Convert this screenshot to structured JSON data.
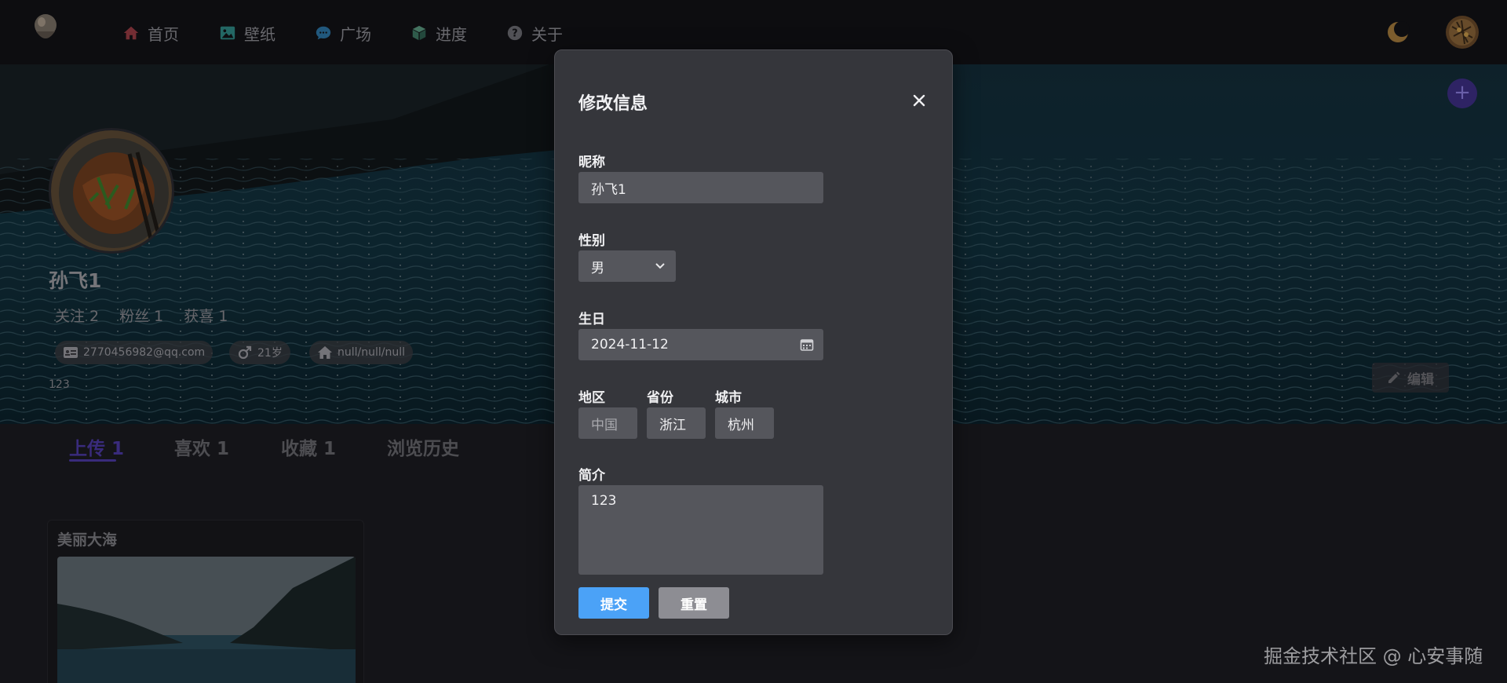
{
  "nav": {
    "items": [
      {
        "label": "首页",
        "icon": "home-icon",
        "color": "#9a3c44"
      },
      {
        "label": "壁纸",
        "icon": "image-icon",
        "color": "#2f8a86"
      },
      {
        "label": "广场",
        "icon": "chat-icon",
        "color": "#2d76a7"
      },
      {
        "label": "进度",
        "icon": "box-icon",
        "color": "#3f7a65"
      },
      {
        "label": "关于",
        "icon": "question-icon",
        "color": "#6d6d73"
      }
    ]
  },
  "profile": {
    "name": "孙飞1",
    "stats": [
      "关注 2",
      "粉丝 1",
      "获喜 1"
    ],
    "email": "2770456982@qq.com",
    "age": "21岁",
    "location": "null/null/null",
    "bio": "123",
    "edit_label": "编辑",
    "add_label": "+"
  },
  "tabs": [
    "上传 1",
    "喜欢 1",
    "收藏 1",
    "浏览历史"
  ],
  "card": {
    "title": "美丽大海"
  },
  "watermark": "掘金技术社区 @ 心安事随",
  "modal": {
    "title": "修改信息",
    "close": "✕",
    "nickname_label": "昵称",
    "nickname_value": "孙飞1",
    "gender_label": "性别",
    "gender_value": "男",
    "birthday_label": "生日",
    "birthday_value": "2024-11-12",
    "region_label": "地区",
    "region_value": "中国",
    "province_label": "省份",
    "province_value": "浙江",
    "city_label": "城市",
    "city_value": "杭州",
    "intro_label": "简介",
    "intro_value": "123",
    "submit_label": "提交",
    "reset_label": "重置"
  },
  "colors": {
    "accent": "#4c3aa6",
    "primary_button": "#4ba2f7",
    "modal_bg": "#35363b"
  }
}
